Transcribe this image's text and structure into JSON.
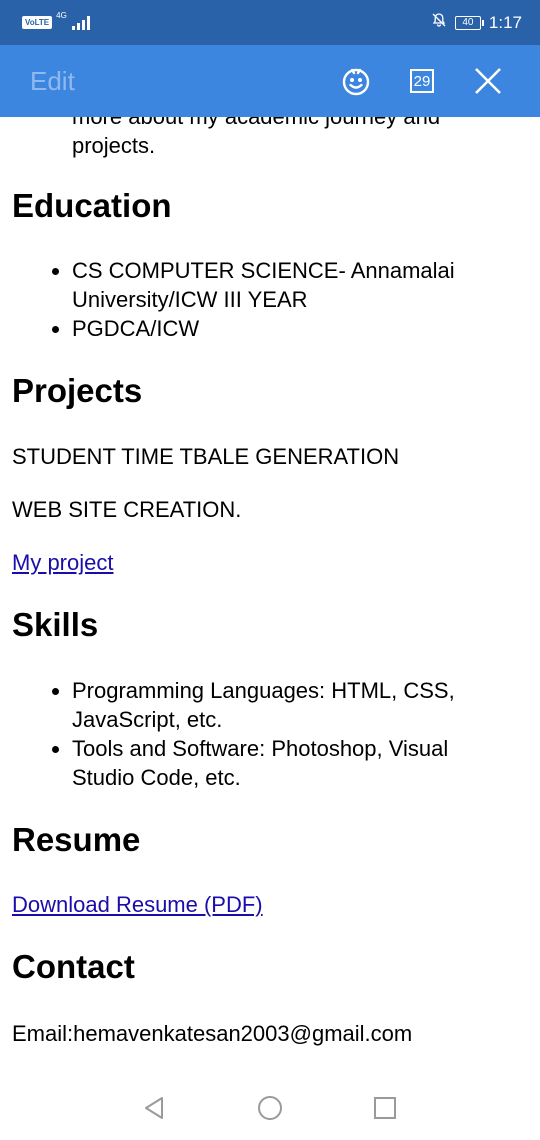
{
  "statusbar": {
    "volte": "VoLTE",
    "network": "4G",
    "battery": "40",
    "time": "1:17"
  },
  "toolbar": {
    "edit_label": "Edit",
    "calendar_day": "29"
  },
  "content": {
    "intro_line1": "more about my academic journey and",
    "intro_line2": "projects.",
    "education": {
      "heading": "Education",
      "items": [
        "CS COMPUTER SCIENCE- Annamalai University/ICW III YEAR",
        "PGDCA/ICW"
      ]
    },
    "projects": {
      "heading": "Projects",
      "p1": "STUDENT TIME TBALE GENERATION",
      "p2": "WEB SITE CREATION.",
      "link": "My project"
    },
    "skills": {
      "heading": "Skills",
      "items": [
        "Programming Languages: HTML, CSS, JavaScript, etc.",
        "Tools and Software: Photoshop, Visual Studio Code, etc."
      ]
    },
    "resume": {
      "heading": "Resume",
      "link": "Download Resume (PDF)"
    },
    "contact": {
      "heading": "Contact",
      "email": "Email:hemavenkatesan2003@gmail.com"
    }
  },
  "icons": {
    "emoji": "smiley-icon",
    "calendar": "calendar-icon",
    "close": "close-icon",
    "back": "back-triangle-icon",
    "home": "home-circle-icon",
    "recents": "recents-square-icon"
  }
}
